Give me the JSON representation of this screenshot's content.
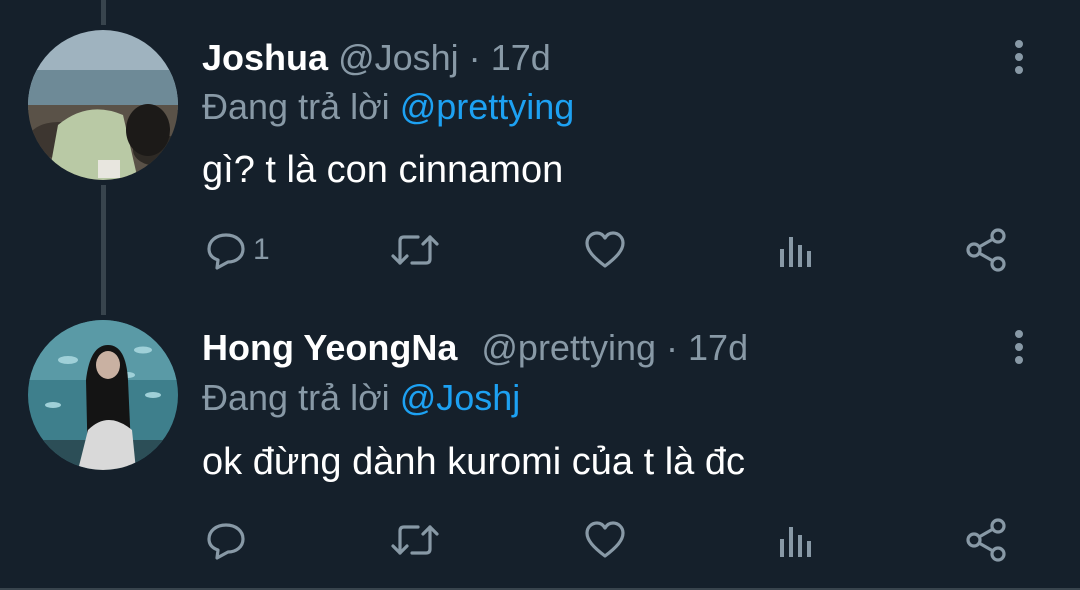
{
  "tweets": [
    {
      "name": "Joshua",
      "handle": "@Joshj",
      "dot": "·",
      "time": "17d",
      "reply_prefix": "Đang trả lời",
      "reply_to": "@prettying",
      "text": "gì? t là con cinnamon",
      "reply_count": "1"
    },
    {
      "name": "Hong YeongNa",
      "handle": "@prettying",
      "dot": "·",
      "time": "17d",
      "reply_prefix": "Đang trả lời",
      "reply_to": "@Joshj",
      "text": "ok đừng dành kuromi của t là đc",
      "reply_count": ""
    }
  ],
  "icons": [
    "reply-icon",
    "retweet-icon",
    "like-icon",
    "analytics-icon",
    "share-icon",
    "more-vertical-icon"
  ],
  "colors": {
    "background": "#15202b",
    "secondary_text": "#8899a6",
    "accent": "#1da1f2",
    "divider": "#38444d"
  }
}
